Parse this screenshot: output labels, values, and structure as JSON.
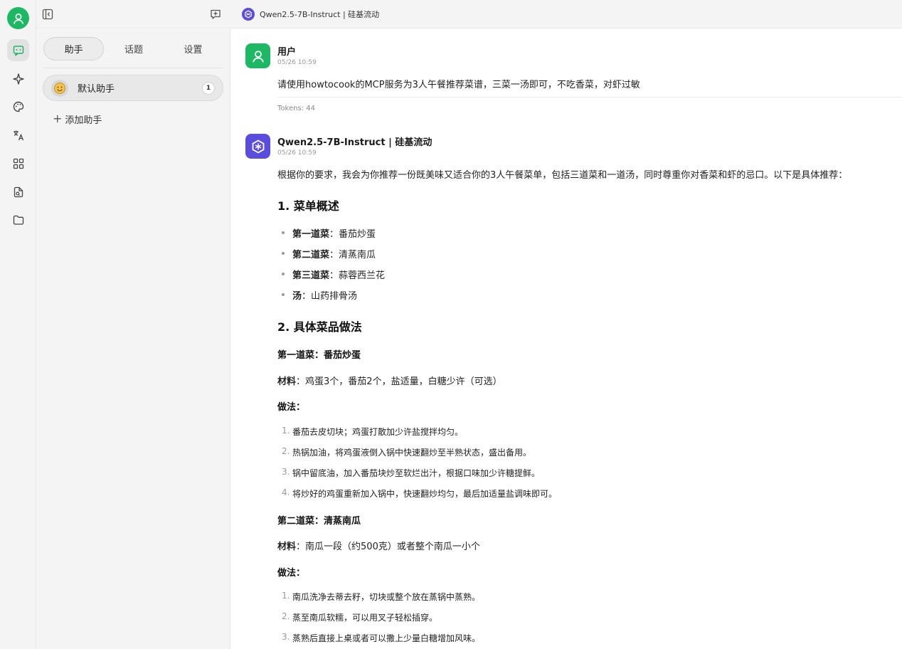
{
  "app": {
    "window_title": "Qwen2.5-7B-Instruct | 硅基流动"
  },
  "rail": {
    "items": [
      {
        "name": "chat-icon",
        "active": true
      },
      {
        "name": "sparkle-icon",
        "active": false
      },
      {
        "name": "palette-icon",
        "active": false
      },
      {
        "name": "translate-icon",
        "active": false
      },
      {
        "name": "apps-grid-icon",
        "active": false
      },
      {
        "name": "file-search-icon",
        "active": false
      },
      {
        "name": "folder-icon",
        "active": false
      }
    ]
  },
  "sidebar": {
    "tabs": [
      "助手",
      "话题",
      "设置"
    ],
    "active_tab": 0,
    "assistant": {
      "name": "默认助手",
      "count": "1"
    },
    "add_label": "添加助手"
  },
  "messages": {
    "user": {
      "name": "用户",
      "time": "05/26 10:59",
      "text": "请使用howtocook的MCP服务为3人午餐推荐菜谱，三菜一汤即可，不吃香菜，对虾过敏",
      "tokens": "Tokens: 44"
    },
    "assistant": {
      "name": "Qwen2.5-7B-Instruct | 硅基流动",
      "time": "05/26 10:59",
      "intro": "根据你的要求，我会为你推荐一份既美味又适合你的3人午餐菜单，包括三道菜和一道汤，同时尊重你对香菜和虾的忌口。以下是具体推荐：",
      "section1_title": "1. 菜单概述",
      "menu": [
        {
          "label": "第一道菜",
          "value": "番茄炒蛋"
        },
        {
          "label": "第二道菜",
          "value": "清蒸南瓜"
        },
        {
          "label": "第三道菜",
          "value": "蒜蓉西兰花"
        },
        {
          "label": "汤",
          "value": "山药排骨汤"
        }
      ],
      "section2_title": "2. 具体菜品做法",
      "dish1": {
        "title": "第一道菜：番茄炒蛋",
        "materials_label": "材料",
        "materials": "鸡蛋3个，番茄2个，盐适量，白糖少许（可选）",
        "method_label": "做法：",
        "steps": [
          "番茄去皮切块；鸡蛋打散加少许盐搅拌均匀。",
          "热锅加油，将鸡蛋液倒入锅中快速翻炒至半熟状态，盛出备用。",
          "锅中留底油，加入番茄块炒至软烂出汁，根据口味加少许糖提鲜。",
          "将炒好的鸡蛋重新加入锅中，快速翻炒均匀，最后加适量盐调味即可。"
        ]
      },
      "dish2": {
        "title": "第二道菜：清蒸南瓜",
        "materials_label": "材料",
        "materials": "南瓜一段（约500克）或者整个南瓜一小个",
        "method_label": "做法：",
        "steps": [
          "南瓜洗净去蒂去籽，切块或整个放在蒸锅中蒸熟。",
          "蒸至南瓜软糯，可以用叉子轻松插穿。",
          "蒸熟后直接上桌或者可以撒上少量白糖增加风味。"
        ]
      }
    }
  },
  "colors": {
    "brand_green": "#1cb864",
    "model_purple": "#5b4ce0"
  }
}
